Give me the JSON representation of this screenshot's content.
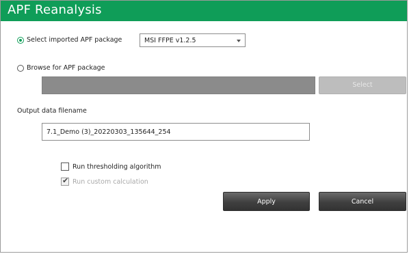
{
  "window": {
    "title": "APF Reanalysis"
  },
  "apf_source": {
    "imported_option_label": "Select imported APF package",
    "imported_selected": true,
    "package_selected_value": "MSI FFPE v1.2.5",
    "browse_option_label": "Browse for APF package",
    "browse_selected": false,
    "browse_path_value": "",
    "select_button_label": "Select"
  },
  "output": {
    "label": "Output data filename",
    "filename_value": "7.1_Demo (3)_20220303_135644_254"
  },
  "options": {
    "thresholding_label": "Run thresholding algorithm",
    "thresholding_checked": false,
    "custom_calc_label": "Run custom calculation",
    "custom_calc_checked": true
  },
  "actions": {
    "apply_label": "Apply",
    "cancel_label": "Cancel"
  },
  "colors": {
    "titlebar": "#0f9d58",
    "radio_accent": "#0f9d58",
    "button_dark": "#3f3f3f"
  },
  "icons": [
    "radio-selected-icon",
    "radio-unselected-icon",
    "chevron-down-icon",
    "checkmark-icon"
  ]
}
